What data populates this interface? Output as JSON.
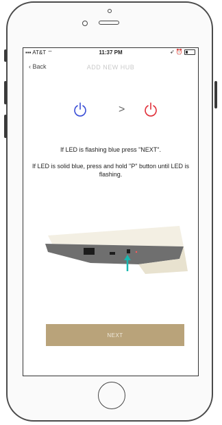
{
  "status_bar": {
    "carrier": "AT&T",
    "time": "11:37 PM"
  },
  "nav": {
    "back_label": "Back",
    "title": "ADD NEW HUB"
  },
  "instructions": {
    "line1": "If LED is flashing blue press \"NEXT\".",
    "line2": "If LED is solid blue, press and hold \"P\" button until LED is flashing."
  },
  "power_states": {
    "from_color": "#3b4fd6",
    "to_color": "#e0303a",
    "separator": ">"
  },
  "next_button": {
    "label": "NEXT",
    "color": "#b9a37a"
  },
  "icons": [
    "power-icon",
    "chevron-right-icon",
    "wifi-icon",
    "battery-icon",
    "arrow-up-icon"
  ]
}
